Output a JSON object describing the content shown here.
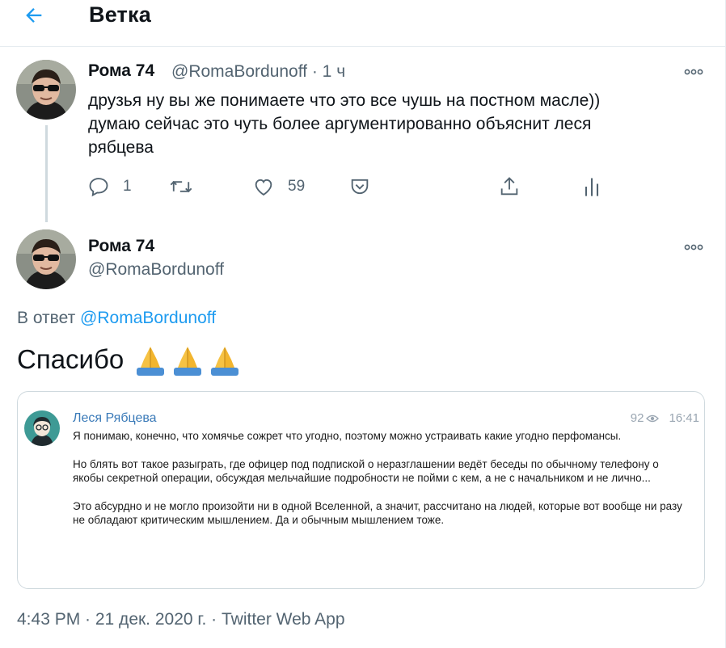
{
  "header": {
    "title": "Ветка"
  },
  "parent_tweet": {
    "name": "Рома 74",
    "handle_time": "@RomaBordunoff · 1 ч",
    "text_lines": [
      "друзья ну вы же понимаете что это все чушь на постном масле))",
      "думаю сейчас это чуть более аргументированно объяснит леся",
      "рябцева"
    ],
    "reply_count": "1",
    "like_count": "59"
  },
  "main_tweet": {
    "name": "Рома 74",
    "handle": "@RomaBordunoff",
    "reply_prefix": "В ответ ",
    "reply_handle": "@RomaBordunoff",
    "text": "Спасибо"
  },
  "embed": {
    "author": "Леся Рябцева",
    "views": "92",
    "time": "16:41",
    "paragraphs": [
      "Я понимаю, конечно, что хомячье сожрет что угодно, поэтому можно устраивать какие угодно перфомансы.",
      "Но блять вот такое разыграть, где офицер под подпиской о неразглашении ведёт беседы по обычному телефону о якобы секретной операции, обсуждая мельчайшие подробности не пойми с кем, а не с начальником и не лично...",
      "Это абсурдно и не могло произойти ни в одной Вселенной, а значит, рассчитано на людей, которые вот вообще ни разу не обладают критическим мышлением. Да и обычным мышлением тоже."
    ]
  },
  "footer": {
    "meta": "4:43 PM · 21 дек. 2020 г. · Twitter Web App"
  },
  "colors": {
    "accent": "#1d9bf0",
    "secondary_text": "#536471",
    "embed_name": "#3a7ab8"
  }
}
